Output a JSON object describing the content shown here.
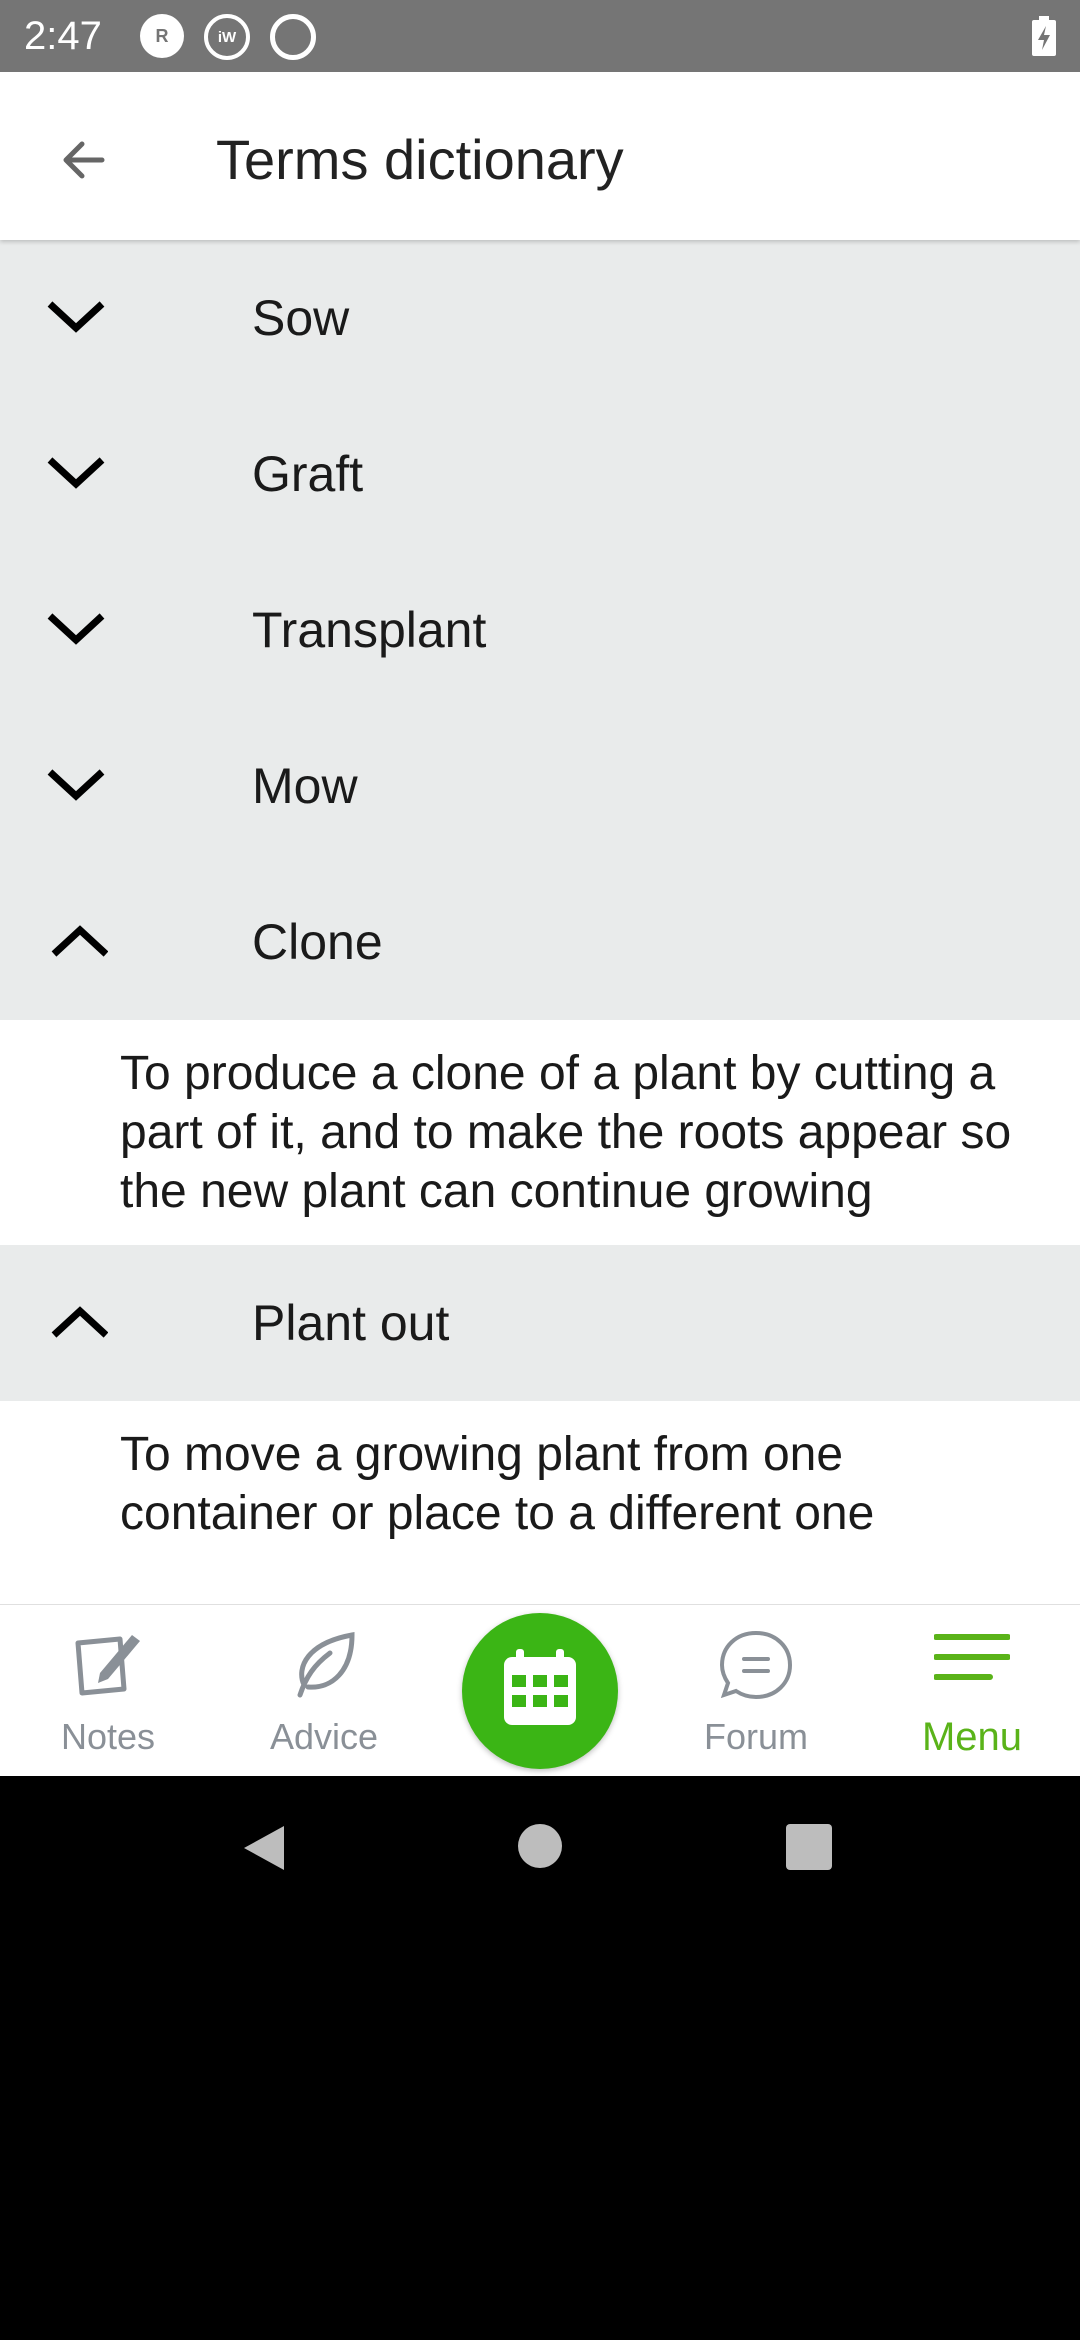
{
  "status_bar": {
    "time": "2:47",
    "icons": [
      "r-icon",
      "iw-icon",
      "sync-icon"
    ],
    "battery": "battery-charging-icon"
  },
  "header": {
    "title": "Terms dictionary",
    "back_icon": "arrow-back-icon"
  },
  "terms": [
    {
      "label": "Sow",
      "expanded": false
    },
    {
      "label": "Graft",
      "expanded": false
    },
    {
      "label": "Transplant",
      "expanded": false
    },
    {
      "label": "Mow",
      "expanded": false
    },
    {
      "label": "Clone",
      "expanded": true,
      "definition": "To produce a clone of a plant by cutting a part of it, and to make the roots appear so the new plant can continue growing"
    },
    {
      "label": "Plant out",
      "expanded": true,
      "definition": "To move a growing plant from one container or place to a different one"
    }
  ],
  "bottom_nav": {
    "items": [
      {
        "label": "Notes",
        "icon": "notes-icon",
        "active": false
      },
      {
        "label": "Advice",
        "icon": "leaf-icon",
        "active": false
      },
      {
        "label": "Forum",
        "icon": "chat-bubble-icon",
        "active": false
      },
      {
        "label": "Menu",
        "icon": "menu-icon",
        "active": true
      }
    ],
    "center_icon": "calendar-icon"
  },
  "colors": {
    "accent_green": "#5ab319",
    "fab_green": "#3bb515",
    "row_background": "#e9ebeb",
    "inactive_nav": "#8a9097"
  }
}
